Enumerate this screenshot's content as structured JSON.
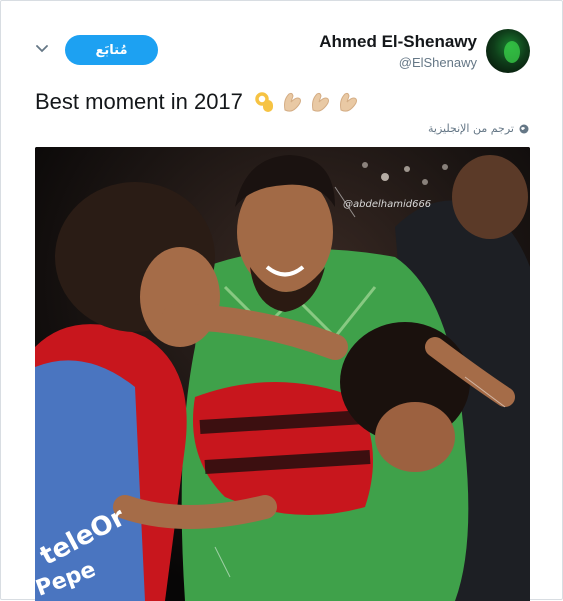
{
  "tweet": {
    "author": {
      "display_name": "Ahmed El-Shenawy",
      "handle": "@ElShenawy"
    },
    "follow_label": "مُتابَع",
    "text": "Best moment in 2017",
    "emojis": [
      "ok-hand-emoji",
      "clapping-hand-emoji",
      "clapping-hand-emoji",
      "clapping-hand-emoji"
    ],
    "translate_label": "ترجم من الإنجليزية",
    "photo": {
      "watermark": "@abdelhamid666",
      "jersey_text_1": "teleOr",
      "jersey_text_2": "Pepe"
    }
  },
  "colors": {
    "accent": "#1da1f2",
    "text_primary": "#14171a",
    "text_secondary": "#657786",
    "jersey_red": "#c8161d",
    "keeper_green": "#3fa14a",
    "bib_blue": "#3c7fd3"
  }
}
